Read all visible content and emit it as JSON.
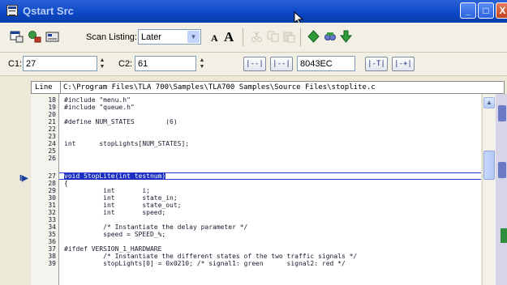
{
  "window": {
    "title": "Qstart Src",
    "minimize_label": "_",
    "maximize_label": "□",
    "close_label": "X"
  },
  "toolbar": {
    "scan_listing_label": "Scan Listing:",
    "scan_listing_value": "Later",
    "font_small_label": "A",
    "font_large_label": "A"
  },
  "controls": {
    "c1_label": "C1:",
    "c1_value": "27",
    "c2_label": "C2:",
    "c2_value": "61",
    "address_value": "8043EC",
    "nav_labels": [
      "|--|",
      "|--|",
      "|-T|",
      "|-+|"
    ]
  },
  "source": {
    "line_header": "Line",
    "file_path": "C:\\Program Files\\TLA 700\\Samples\\TLA700 Samples\\Source Files\\stoplite.c",
    "lines": [
      {
        "num": "18",
        "code": "#include \"menu.h\""
      },
      {
        "num": "19",
        "code": "#include \"queue.h\""
      },
      {
        "num": "20",
        "code": ""
      },
      {
        "num": "21",
        "code": "#define NUM_STATES        (6)"
      },
      {
        "num": "22",
        "code": ""
      },
      {
        "num": "23",
        "code": ""
      },
      {
        "num": "24",
        "code": "int      stopLights[NUM_STATES];"
      },
      {
        "num": "25",
        "code": ""
      },
      {
        "num": "26",
        "code": ""
      },
      {
        "num": "27",
        "code": "void StopLite(int testnum)"
      },
      {
        "num": "28",
        "code": "{"
      },
      {
        "num": "29",
        "code": "          int       i;"
      },
      {
        "num": "30",
        "code": "          int       state_in;"
      },
      {
        "num": "31",
        "code": "          int       state_out;"
      },
      {
        "num": "32",
        "code": "          int       speed;"
      },
      {
        "num": "33",
        "code": ""
      },
      {
        "num": "34",
        "code": "          /* Instantiate the delay parameter */"
      },
      {
        "num": "35",
        "code": "          speed = SPEED_%;"
      },
      {
        "num": "36",
        "code": ""
      },
      {
        "num": "37",
        "code": "#ifdef VERSION_1_HARDWARE"
      },
      {
        "num": "38",
        "code": "          /* Instantiate the different states of the two traffic signals */"
      },
      {
        "num": "39",
        "code": "          stopLights[0] = 0x0210; /* signal1: green      signal2: red */"
      }
    ],
    "selected_line": "27"
  },
  "colors": {
    "title_bar": "#0b46c4",
    "highlight": "#1c2ec0",
    "chrome": "#ece9d8"
  }
}
